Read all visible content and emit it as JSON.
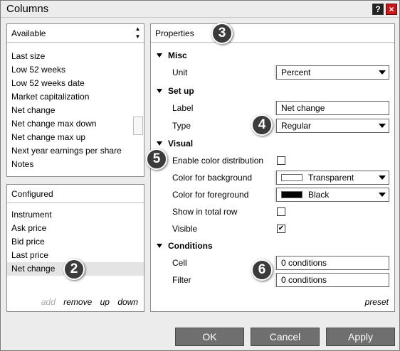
{
  "window": {
    "title": "Columns",
    "help_label": "?",
    "close_label": "×"
  },
  "available": {
    "header": "Available",
    "scroll_up": "▲",
    "scroll_down": "▼",
    "items": [
      "Last size",
      "Low 52 weeks",
      "Low 52 weeks date",
      "Market capitalization",
      "Net change",
      "Net change max down",
      "Net change max up",
      "Next year earnings per share",
      "Notes"
    ]
  },
  "configured": {
    "header": "Configured",
    "items": [
      "Instrument",
      "Ask price",
      "Bid price",
      "Last price",
      "Net change"
    ],
    "selected_index": 4,
    "actions": {
      "add": "add",
      "remove": "remove",
      "up": "up",
      "down": "down"
    }
  },
  "properties": {
    "header": "Properties",
    "sections": {
      "misc": "Misc",
      "setup": "Set up",
      "visual": "Visual",
      "conditions": "Conditions"
    },
    "unit": {
      "label": "Unit",
      "value": "Percent"
    },
    "label_field": {
      "label": "Label",
      "value": "Net change"
    },
    "type": {
      "label": "Type",
      "value": "Regular"
    },
    "enable_color_distribution": {
      "label": "Enable color distribution",
      "checked": false
    },
    "color_background": {
      "label": "Color for background",
      "value": "Transparent",
      "swatch": "#ffffff"
    },
    "color_foreground": {
      "label": "Color for foreground",
      "value": "Black",
      "swatch": "#000000"
    },
    "show_in_total_row": {
      "label": "Show in total row",
      "checked": false
    },
    "visible": {
      "label": "Visible",
      "checked": true
    },
    "cell": {
      "label": "Cell",
      "value": "0 conditions"
    },
    "filter": {
      "label": "Filter",
      "value": "0 conditions"
    },
    "preset": "preset"
  },
  "badges": [
    "2",
    "3",
    "4",
    "5",
    "6"
  ],
  "buttons": {
    "ok": "OK",
    "cancel": "Cancel",
    "apply": "Apply"
  },
  "colors": {
    "button_bg": "#6f6f6f",
    "badge_bg": "#3b3b3b",
    "close_red": "#c4181c"
  }
}
